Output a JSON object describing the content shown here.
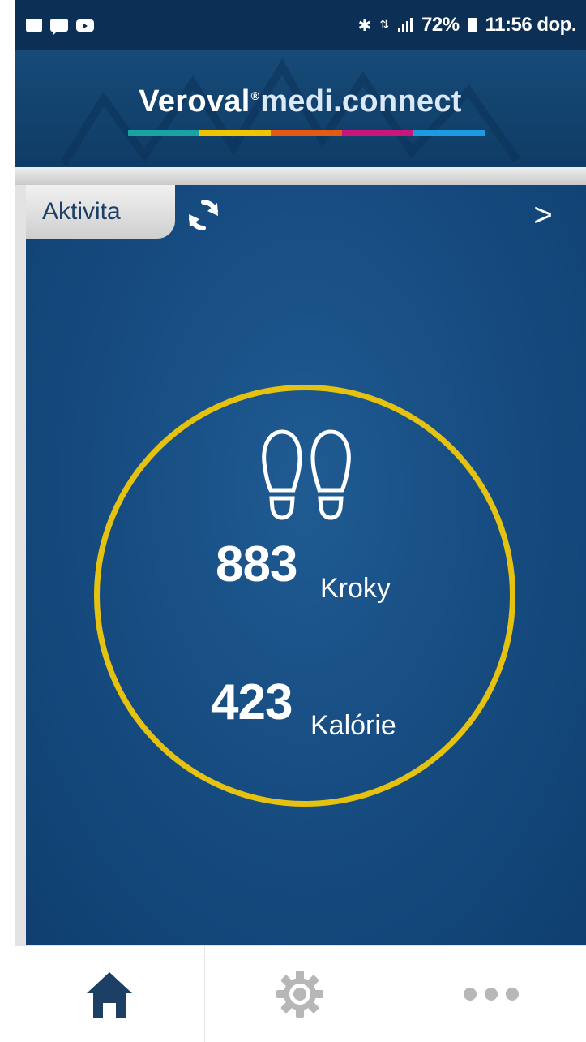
{
  "status_bar": {
    "battery": "72%",
    "time": "11:56 dop.",
    "icons": [
      "picture-icon",
      "chat-icon",
      "youtube-icon",
      "bluetooth-icon",
      "data-icon",
      "signal-icon",
      "battery-icon"
    ]
  },
  "header": {
    "brand_a": "Veroval",
    "brand_reg": "®",
    "brand_b": "medi.connect",
    "stripe_colors": [
      "#1aa3a3",
      "#f2c400",
      "#e35a14",
      "#c8167a",
      "#1e9be0"
    ]
  },
  "panel": {
    "tab_label": "Aktivita",
    "next_label": ">"
  },
  "metrics": {
    "steps_value": "883",
    "steps_label": "Kroky",
    "calories_value": "423",
    "calories_label": "Kalórie"
  },
  "nav": {
    "items": [
      "home-icon",
      "settings-icon",
      "more-icon"
    ]
  },
  "colors": {
    "ring": "#e5c20f",
    "panel": "#174d82",
    "header": "#0f3c66",
    "nav_active": "#1c3f66",
    "nav_inactive": "#b7b7b7"
  }
}
